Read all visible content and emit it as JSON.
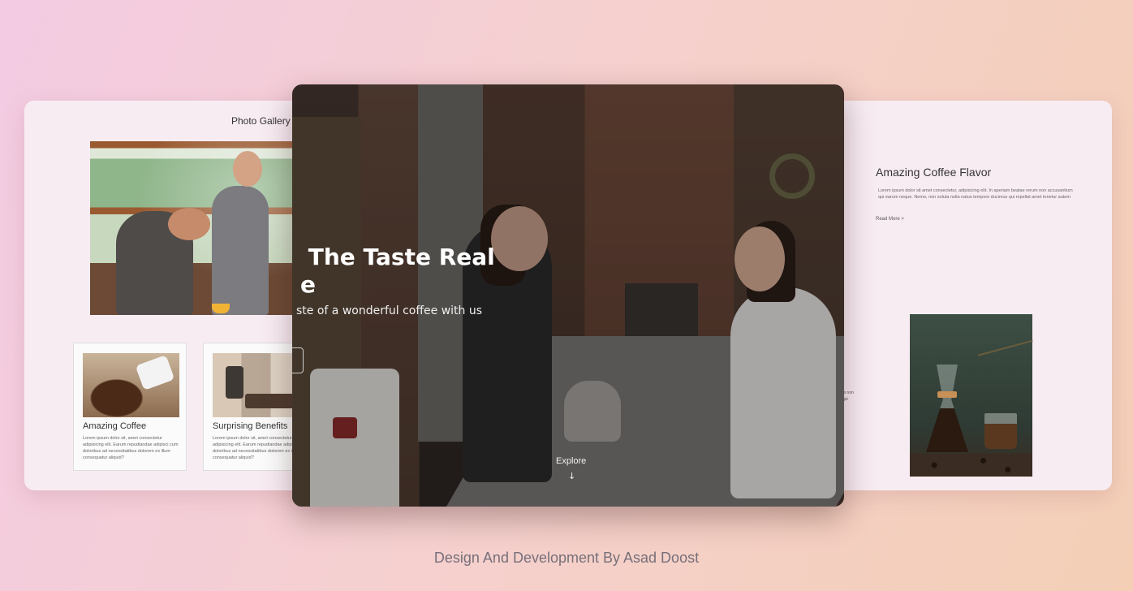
{
  "gallery": {
    "title": "Photo Gallery"
  },
  "cards": [
    {
      "title": "Amazing Coffee",
      "text": "Lorem ipsum dolor sit, amet consectetur adipisicing elit. Earum repudiandae adipisci cum doloribus ad necessitatibus dolorem ex illum consequatur aliquid?"
    },
    {
      "title": "Surprising Benefits",
      "text": "Lorem ipsum dolor sit, amet consectetur adipisicing elit. Earum repudiandae adipisci cum doloribus ad necessitatibus dolorem ex illum consequatur aliquid?"
    }
  ],
  "flavor": {
    "title": "Amazing Coffee Flavor",
    "text": "Lorem ipsum dolor sit amet consectetur, adipisicing elit. In aperiam beatae rerum non accusantium qui earum neque. Nemo, non soluta nulla natus tempore ducimus qui repellat amet tenetur autem",
    "read_more": "Read More >",
    "side_snippet": "m non\nqui"
  },
  "hero": {
    "heading": " The Taste Real\ne",
    "subheading": "ste of a wonderful coffee with us",
    "explore_label": "Explore",
    "explore_arrow": "↓"
  },
  "footer": {
    "credit": "Design And Development By Asad Doost"
  }
}
